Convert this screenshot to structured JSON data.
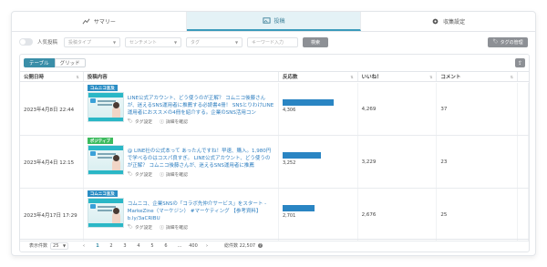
{
  "tabs": [
    {
      "label": "サマリー",
      "icon": "chart-line-icon",
      "active": false
    },
    {
      "label": "投稿",
      "icon": "image-post-icon",
      "active": true
    },
    {
      "label": "収集設定",
      "icon": "gear-icon",
      "active": false
    }
  ],
  "filters": {
    "popular_toggle_label": "人気投稿",
    "post_type_placeholder": "投稿タイプ",
    "sentiment_placeholder": "センチメント",
    "tag_placeholder": "タグ",
    "keyword_placeholder": "キーワード入力",
    "search_label": "検索",
    "tag_manage_label": "タグの管理"
  },
  "view_switch": {
    "table": "テーブル",
    "grid": "グリッド"
  },
  "columns": {
    "date": "公開日時",
    "content": "投稿内容",
    "reactions": "反応数",
    "likes": "いいね！",
    "comments": "コメント"
  },
  "rows": [
    {
      "date": "2023年4月8日 22:44",
      "badge": "コムニコ言及",
      "badge_color": "#2a8dc4",
      "text": "LINE公式アカウント、どう使うのが正解？ コムニコ後藤さんが、迷えるSNS運用者に推薦する必読書4冊！ SNSとりわけLINE運用者におススメの4冊を紹介する。企業のSNS活用コン",
      "tag_action": "タグ設定",
      "detail_action": "詳細を確認",
      "reactions": 4306,
      "reactions_label": "4,306",
      "likes": "4,269",
      "comments": "37"
    },
    {
      "date": "2023年4月4日 12:15",
      "badge": "ポジティブ",
      "badge_color": "#3cbb5e",
      "text": "@ LINE社の公式本って あったんですね！早速、購入。1,980円で学べるのはコスパ良すぎ。 LINE公式アカウント、どう使うのが正解？ コムニコ後藤さんが、迷えるSNS運用者に推薦",
      "tag_action": "タグ設定",
      "detail_action": "詳細を確認",
      "reactions": 3252,
      "reactions_label": "3,252",
      "likes": "3,229",
      "comments": "23"
    },
    {
      "date": "2023年4月17日 17:29",
      "badge": "コムニコ言及",
      "badge_color": "#2a8dc4",
      "text": "コムニコ、企業SNSの「コラボ先仲介サービス」をスタート - MarkeZine（マーケジン） #マーケティング 【参考資料】 b.ly/3aCRIBU",
      "tag_action": "タグ設定",
      "detail_action": "詳細を確認",
      "reactions": 2701,
      "reactions_label": "2,701",
      "likes": "2,676",
      "comments": "25"
    }
  ],
  "pager": {
    "per_page_label": "表示件数",
    "per_page": "25",
    "pages": [
      "1",
      "2",
      "3",
      "4",
      "5",
      "6"
    ],
    "ellipsis": "…",
    "last_page": "400",
    "total_label": "総件数 22,507"
  },
  "colors": {
    "accent": "#3a8ea8",
    "bar": "#2a85c3",
    "link": "#2f7fc0"
  }
}
